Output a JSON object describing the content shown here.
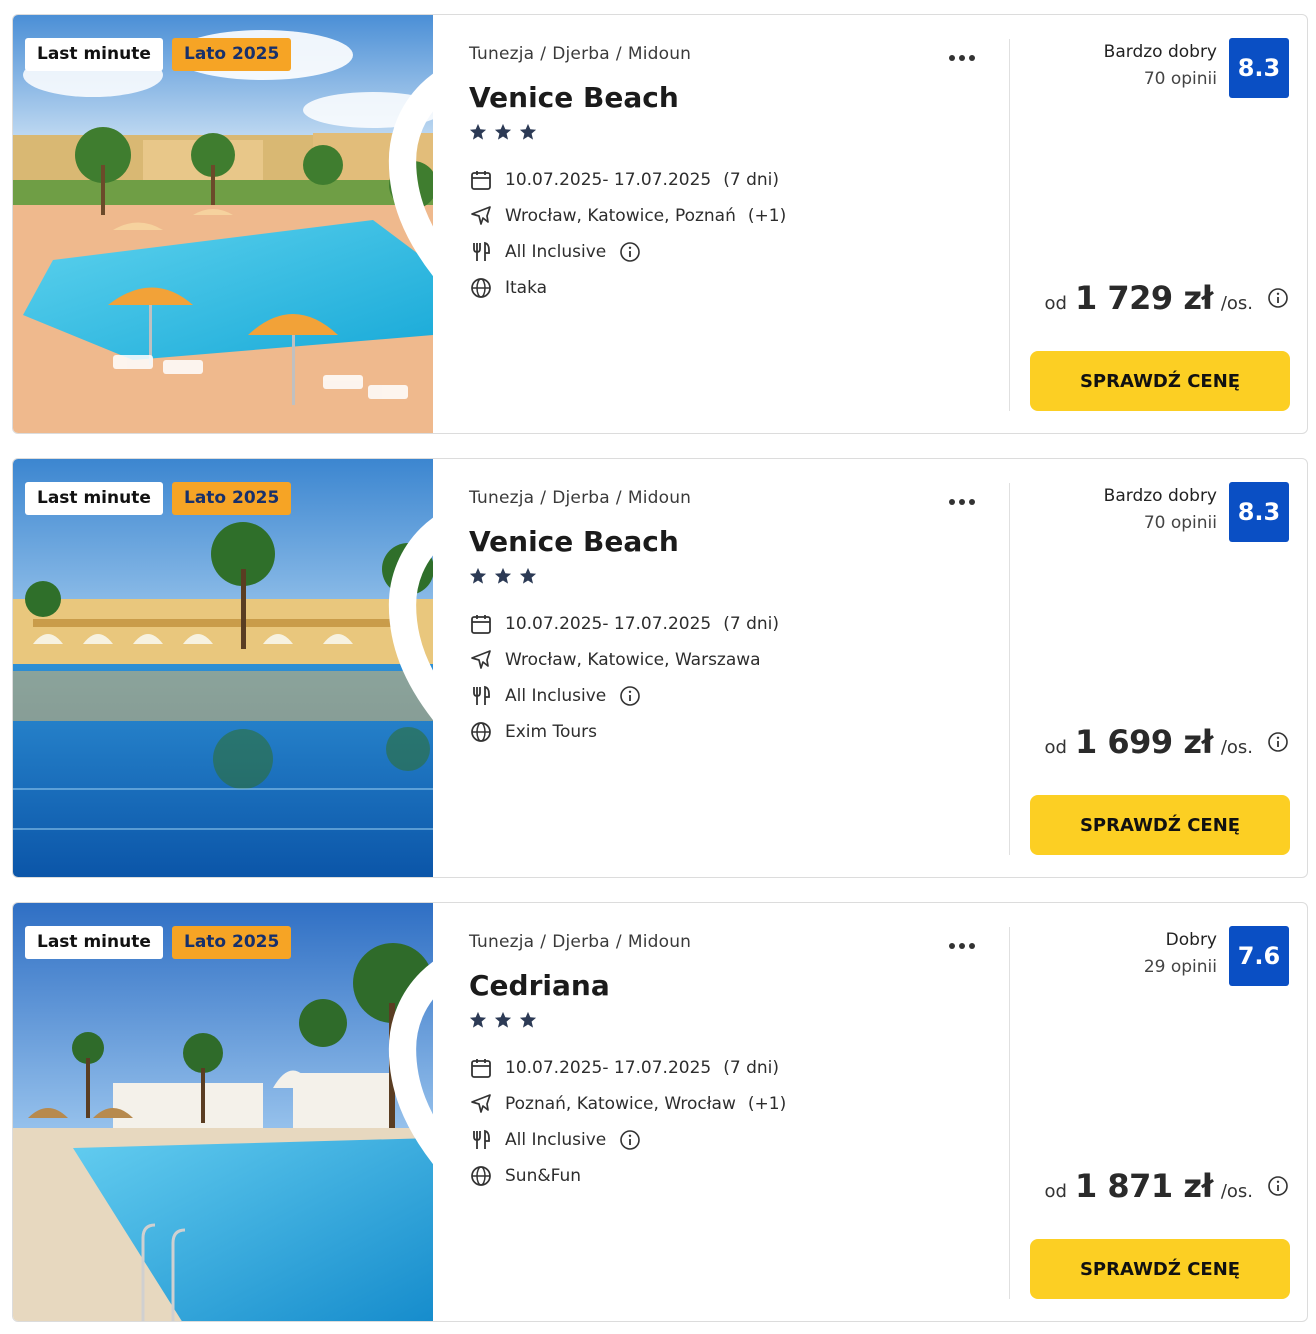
{
  "offers": [
    {
      "badges": {
        "last_minute": "Last minute",
        "season": "Lato 2025"
      },
      "breadcrumb": [
        "Tunezja",
        "Djerba",
        "Midoun"
      ],
      "name": "Venice Beach",
      "stars": 3,
      "dates": "10.07.2025- 17.07.2025",
      "duration": "(7 dni)",
      "departures": "Wrocław, Katowice, Poznań",
      "departures_extra": "(+1)",
      "board": "All Inclusive",
      "operator": "Itaka",
      "rating_label": "Bardzo dobry",
      "rating_count": "70 opinii",
      "score": "8.3",
      "price_prefix": "od",
      "price": "1 729 zł",
      "price_suffix": "/os.",
      "cta": "SPRAWDŹ CENĘ",
      "photo": "resort-pool-with-umbrellas"
    },
    {
      "badges": {
        "last_minute": "Last minute",
        "season": "Lato 2025"
      },
      "breadcrumb": [
        "Tunezja",
        "Djerba",
        "Midoun"
      ],
      "name": "Venice Beach",
      "stars": 3,
      "dates": "10.07.2025- 17.07.2025",
      "duration": "(7 dni)",
      "departures": "Wrocław, Katowice, Warszawa",
      "departures_extra": "",
      "board": "All Inclusive",
      "operator": "Exim Tours",
      "rating_label": "Bardzo dobry",
      "rating_count": "70 opinii",
      "score": "8.3",
      "price_prefix": "od",
      "price": "1 699 zł",
      "price_suffix": "/os.",
      "cta": "SPRAWDŹ CENĘ",
      "photo": "pool-reflection-with-palms"
    },
    {
      "badges": {
        "last_minute": "Last minute",
        "season": "Lato 2025"
      },
      "breadcrumb": [
        "Tunezja",
        "Djerba",
        "Midoun"
      ],
      "name": "Cedriana",
      "stars": 3,
      "dates": "10.07.2025- 17.07.2025",
      "duration": "(7 dni)",
      "departures": "Poznań, Katowice, Wrocław",
      "departures_extra": "(+1)",
      "board": "All Inclusive",
      "operator": "Sun&Fun",
      "rating_label": "Dobry",
      "rating_count": "29 opinii",
      "score": "7.6",
      "price_prefix": "od",
      "price": "1 871 zł",
      "price_suffix": "/os.",
      "cta": "SPRAWDŹ CENĘ",
      "photo": "pool-with-palm-trees"
    }
  ],
  "colors": {
    "score_bg": "#0a4fc4",
    "cta_bg": "#fccf23",
    "season_badge_bg": "#f6a425",
    "season_badge_text": "#17306b"
  }
}
